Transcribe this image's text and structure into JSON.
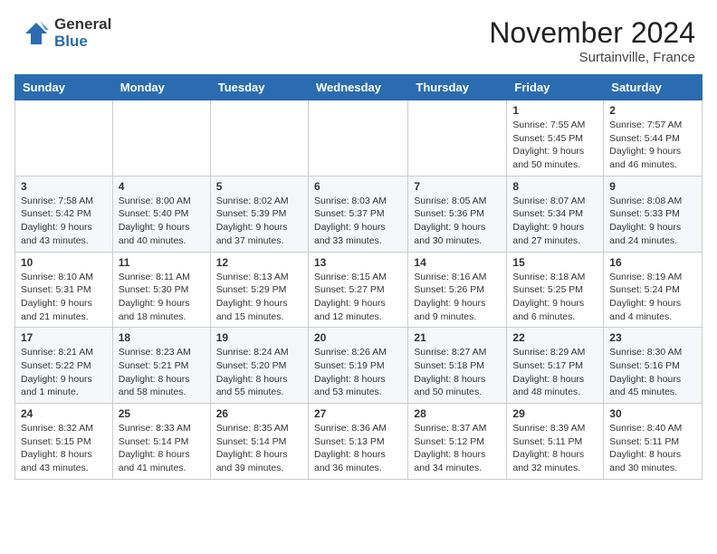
{
  "logo": {
    "general": "General",
    "blue": "Blue"
  },
  "title": "November 2024",
  "location": "Surtainville, France",
  "days_of_week": [
    "Sunday",
    "Monday",
    "Tuesday",
    "Wednesday",
    "Thursday",
    "Friday",
    "Saturday"
  ],
  "weeks": [
    [
      {
        "day": "",
        "info": ""
      },
      {
        "day": "",
        "info": ""
      },
      {
        "day": "",
        "info": ""
      },
      {
        "day": "",
        "info": ""
      },
      {
        "day": "",
        "info": ""
      },
      {
        "day": "1",
        "info": "Sunrise: 7:55 AM\nSunset: 5:45 PM\nDaylight: 9 hours and 50 minutes."
      },
      {
        "day": "2",
        "info": "Sunrise: 7:57 AM\nSunset: 5:44 PM\nDaylight: 9 hours and 46 minutes."
      }
    ],
    [
      {
        "day": "3",
        "info": "Sunrise: 7:58 AM\nSunset: 5:42 PM\nDaylight: 9 hours and 43 minutes."
      },
      {
        "day": "4",
        "info": "Sunrise: 8:00 AM\nSunset: 5:40 PM\nDaylight: 9 hours and 40 minutes."
      },
      {
        "day": "5",
        "info": "Sunrise: 8:02 AM\nSunset: 5:39 PM\nDaylight: 9 hours and 37 minutes."
      },
      {
        "day": "6",
        "info": "Sunrise: 8:03 AM\nSunset: 5:37 PM\nDaylight: 9 hours and 33 minutes."
      },
      {
        "day": "7",
        "info": "Sunrise: 8:05 AM\nSunset: 5:36 PM\nDaylight: 9 hours and 30 minutes."
      },
      {
        "day": "8",
        "info": "Sunrise: 8:07 AM\nSunset: 5:34 PM\nDaylight: 9 hours and 27 minutes."
      },
      {
        "day": "9",
        "info": "Sunrise: 8:08 AM\nSunset: 5:33 PM\nDaylight: 9 hours and 24 minutes."
      }
    ],
    [
      {
        "day": "10",
        "info": "Sunrise: 8:10 AM\nSunset: 5:31 PM\nDaylight: 9 hours and 21 minutes."
      },
      {
        "day": "11",
        "info": "Sunrise: 8:11 AM\nSunset: 5:30 PM\nDaylight: 9 hours and 18 minutes."
      },
      {
        "day": "12",
        "info": "Sunrise: 8:13 AM\nSunset: 5:29 PM\nDaylight: 9 hours and 15 minutes."
      },
      {
        "day": "13",
        "info": "Sunrise: 8:15 AM\nSunset: 5:27 PM\nDaylight: 9 hours and 12 minutes."
      },
      {
        "day": "14",
        "info": "Sunrise: 8:16 AM\nSunset: 5:26 PM\nDaylight: 9 hours and 9 minutes."
      },
      {
        "day": "15",
        "info": "Sunrise: 8:18 AM\nSunset: 5:25 PM\nDaylight: 9 hours and 6 minutes."
      },
      {
        "day": "16",
        "info": "Sunrise: 8:19 AM\nSunset: 5:24 PM\nDaylight: 9 hours and 4 minutes."
      }
    ],
    [
      {
        "day": "17",
        "info": "Sunrise: 8:21 AM\nSunset: 5:22 PM\nDaylight: 9 hours and 1 minute."
      },
      {
        "day": "18",
        "info": "Sunrise: 8:23 AM\nSunset: 5:21 PM\nDaylight: 8 hours and 58 minutes."
      },
      {
        "day": "19",
        "info": "Sunrise: 8:24 AM\nSunset: 5:20 PM\nDaylight: 8 hours and 55 minutes."
      },
      {
        "day": "20",
        "info": "Sunrise: 8:26 AM\nSunset: 5:19 PM\nDaylight: 8 hours and 53 minutes."
      },
      {
        "day": "21",
        "info": "Sunrise: 8:27 AM\nSunset: 5:18 PM\nDaylight: 8 hours and 50 minutes."
      },
      {
        "day": "22",
        "info": "Sunrise: 8:29 AM\nSunset: 5:17 PM\nDaylight: 8 hours and 48 minutes."
      },
      {
        "day": "23",
        "info": "Sunrise: 8:30 AM\nSunset: 5:16 PM\nDaylight: 8 hours and 45 minutes."
      }
    ],
    [
      {
        "day": "24",
        "info": "Sunrise: 8:32 AM\nSunset: 5:15 PM\nDaylight: 8 hours and 43 minutes."
      },
      {
        "day": "25",
        "info": "Sunrise: 8:33 AM\nSunset: 5:14 PM\nDaylight: 8 hours and 41 minutes."
      },
      {
        "day": "26",
        "info": "Sunrise: 8:35 AM\nSunset: 5:14 PM\nDaylight: 8 hours and 39 minutes."
      },
      {
        "day": "27",
        "info": "Sunrise: 8:36 AM\nSunset: 5:13 PM\nDaylight: 8 hours and 36 minutes."
      },
      {
        "day": "28",
        "info": "Sunrise: 8:37 AM\nSunset: 5:12 PM\nDaylight: 8 hours and 34 minutes."
      },
      {
        "day": "29",
        "info": "Sunrise: 8:39 AM\nSunset: 5:11 PM\nDaylight: 8 hours and 32 minutes."
      },
      {
        "day": "30",
        "info": "Sunrise: 8:40 AM\nSunset: 5:11 PM\nDaylight: 8 hours and 30 minutes."
      }
    ]
  ]
}
